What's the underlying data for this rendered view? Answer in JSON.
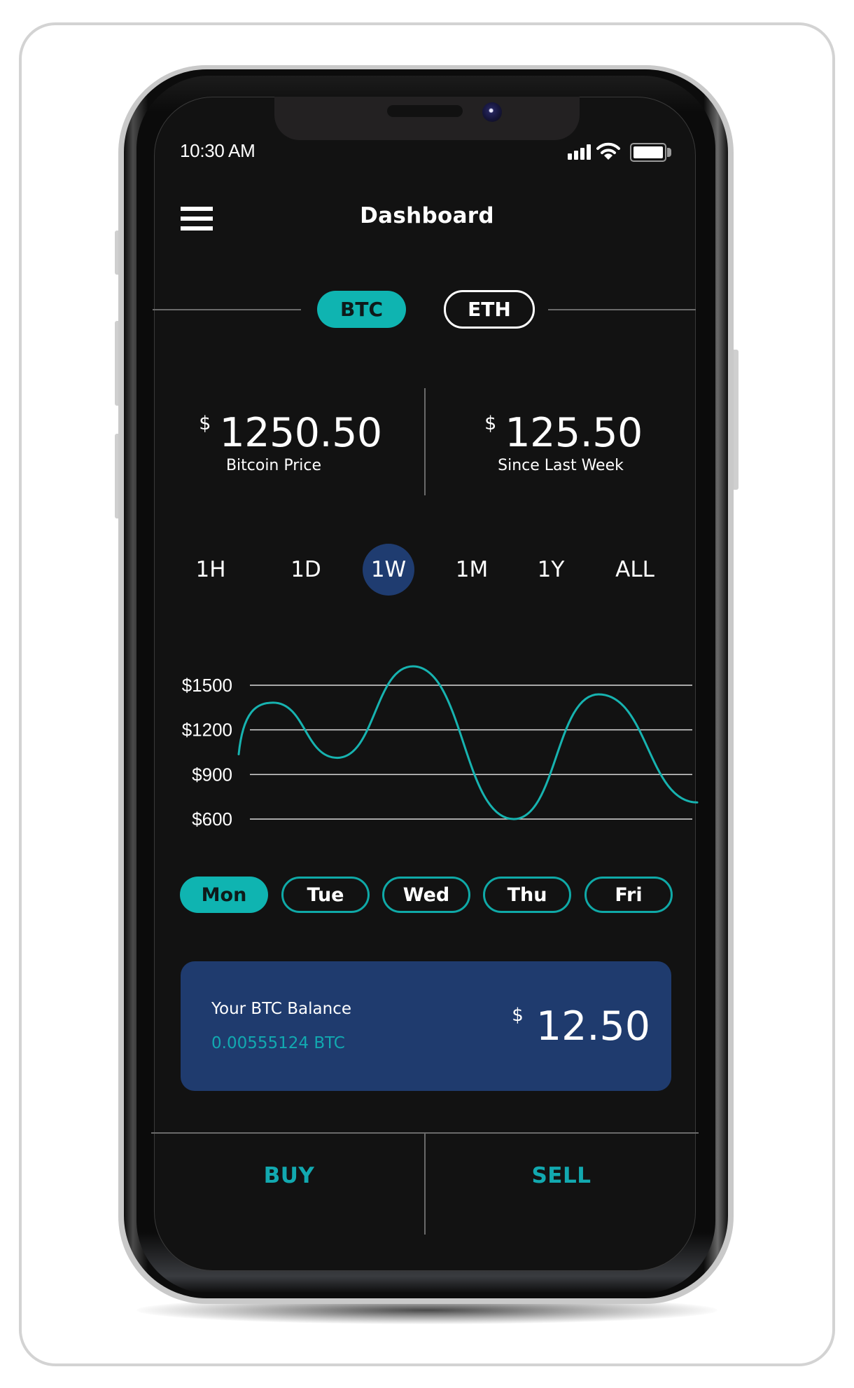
{
  "status_bar": {
    "time": "10:30 AM",
    "icons": [
      "signal-icon",
      "wifi-icon",
      "battery-icon"
    ],
    "battery_level": 1.0
  },
  "header": {
    "menu_icon": "hamburger-menu-icon",
    "title": "Dashboard"
  },
  "coin_tabs": [
    {
      "label": "BTC",
      "active": true
    },
    {
      "label": "ETH",
      "active": false
    }
  ],
  "stats": {
    "price": {
      "currency": "$",
      "value": "1250.50",
      "label": "Bitcoin Price"
    },
    "change": {
      "currency": "$",
      "value": "125.50",
      "label": "Since Last Week"
    }
  },
  "time_ranges": [
    {
      "label": "1H",
      "active": false
    },
    {
      "label": "1D",
      "active": false
    },
    {
      "label": "1W",
      "active": true
    },
    {
      "label": "1M",
      "active": false
    },
    {
      "label": "1Y",
      "active": false
    },
    {
      "label": "ALL",
      "active": false
    }
  ],
  "chart_data": {
    "type": "line",
    "title": "",
    "xlabel": "",
    "ylabel": "",
    "ylim": [
      600,
      1500
    ],
    "yticks": [
      1500,
      1200,
      900,
      600
    ],
    "ytick_labels": [
      "$1500",
      "$1200",
      "$900",
      "$600"
    ],
    "grid": true,
    "series": [
      {
        "name": "BTC price (1W)",
        "x": [
          0,
          0.075,
          0.215,
          0.38,
          0.6,
          0.785,
          1.0
        ],
        "values": [
          1036,
          1383,
          1012,
          1627,
          600,
          1439,
          712
        ]
      }
    ],
    "colors": {
      "line": "#17b3b0",
      "grid": "#d9d9d9"
    }
  },
  "days": [
    {
      "label": "Mon",
      "active": true
    },
    {
      "label": "Tue",
      "active": false
    },
    {
      "label": "Wed",
      "active": false
    },
    {
      "label": "Thu",
      "active": false
    },
    {
      "label": "Fri",
      "active": false
    }
  ],
  "balance": {
    "title": "Your BTC Balance",
    "btc_amount": "0.00555124 BTC",
    "currency": "$",
    "usd_value": "12.50"
  },
  "actions": {
    "buy": "BUY",
    "sell": "SELL"
  },
  "colors": {
    "accent": "#0fb4b1",
    "navy": "#1f3b6e",
    "background": "#121212"
  }
}
